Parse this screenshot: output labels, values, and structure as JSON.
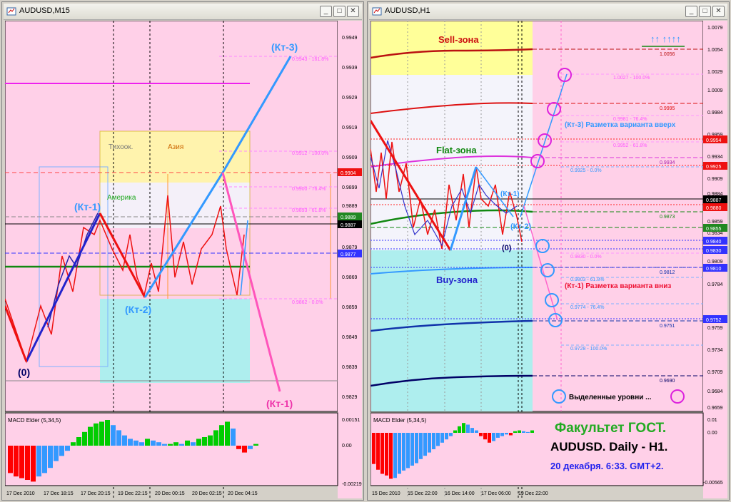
{
  "left_window": {
    "title": "AUDUSD,M15",
    "y_ticks": [
      "0.9949",
      "0.9939",
      "0.9929",
      "0.9919",
      "0.9909",
      "0.9899",
      "0.9889",
      "0.9879",
      "0.9869",
      "0.9859",
      "0.9849",
      "0.9839",
      "0.9829"
    ],
    "price_tags": [
      "0.9904",
      "0.9889",
      "0.9887",
      "0.9877"
    ],
    "fib_labels": [
      "0.9943 - 161.8%",
      "0.9912 - 100.0%",
      "0.9900 - 76.4%",
      "0.9893 - 61.8%",
      "0.9862 - 0.0%"
    ],
    "session_labels": [
      "Тихоок.",
      "Азия",
      "Америка"
    ],
    "wave_labels": [
      "(Кт-3)",
      "(Кт-1)",
      "(Кт-2)",
      "(0)",
      "(Кт-1)"
    ],
    "macd_title": "MACD Elder (5,34,5)",
    "macd_ticks": [
      "0.00151",
      "0.00",
      "-0.00219"
    ],
    "x_ticks": [
      "17 Dec 2010",
      "17 Dec 18:15",
      "17 Dec 20:15",
      "19 Dec 22:15",
      "20 Dec 00:15",
      "20 Dec 02:15",
      "20 Dec 04:15"
    ]
  },
  "right_window": {
    "title": "AUDUSD,H1",
    "y_ticks": [
      "1.0079",
      "1.0054",
      "1.0029",
      "1.0009",
      "0.9984",
      "0.9959",
      "0.9934",
      "0.9909",
      "0.9884",
      "0.9859",
      "0.9834",
      "0.9809",
      "0.9784",
      "0.9759",
      "0.9734",
      "0.9709",
      "0.9684",
      "0.9659"
    ],
    "price_tags": [
      "0.9954",
      "0.9925",
      "0.9887",
      "0.9880",
      "0.9855",
      "0.9840",
      "0.9830",
      "0.9810",
      "0.9752"
    ],
    "level_labels": [
      "1.0056",
      "0.9995",
      "0.9934",
      "0.9873",
      "0.9812",
      "0.9751",
      "0.9690"
    ],
    "fib_labels": [
      "1.0027 - 100.0%",
      "0.9981 - 76.4%",
      "0.9952 - 61.8%",
      "0.9925 - 0.0%",
      "0.9830 - 0.0%",
      "0.9803 - 61.8%",
      "0.9774 - 76.4%",
      "0.9728 - 100.0%"
    ],
    "zone_labels": [
      "Sell-зона",
      "Flat-зона",
      "Buy-зона"
    ],
    "wave_labels": [
      "(Кт-1)",
      "(Кт-2)",
      "(0)"
    ],
    "annotation_up": "(Кт-3) Разметка варианта вверх",
    "annotation_down": "(Кт-1) Разметка варианта вниз",
    "legend_text": "Выделенные уровни ...",
    "arrows_text": "↑↑ ↑↑↑↑",
    "macd_title": "MACD Elder (5,34,5)",
    "macd_ticks": [
      "0.01",
      "0.00",
      "-0.00565"
    ],
    "x_ticks": [
      "15 Dec 2010",
      "15 Dec 22:00",
      "16 Dec 14:00",
      "17 Dec 06:00",
      "19 Dec 22:00"
    ],
    "brand": "Факультет ГОСТ.",
    "headline": "AUDUSD. Daily - H1.",
    "date_line": "20 декабря. 6:33. GMT+2."
  },
  "colors": {
    "chart_bg": "#ffd0e8",
    "macd_green": "#00cc00",
    "macd_red": "#ff0000",
    "macd_blue": "#3399ff",
    "wave_blue": "#3399ff",
    "wave_red": "#ff0000",
    "wave_pink": "#ff66cc"
  },
  "chart_data": [
    {
      "type": "line",
      "name": "AUDUSD,M15",
      "ylim": [
        0.9823,
        0.9957
      ],
      "wave_points": [
        [
          0,
          0.9842
        ],
        [
          1,
          0.9889
        ],
        [
          2,
          0.9862
        ],
        [
          3,
          0.9904
        ],
        [
          4,
          0.9943
        ],
        [
          5,
          0.9829
        ]
      ],
      "horizontal_levels": [
        0.9904,
        0.9889,
        0.9887,
        0.9877,
        0.9872,
        0.9932
      ],
      "macd": [
        -0.0016,
        -0.0018,
        -0.0019,
        -0.002,
        -0.0021,
        -0.0018,
        -0.0016,
        -0.0013,
        -0.0009,
        -0.0006,
        -0.0003,
        0.0002,
        0.0005,
        0.0008,
        0.0011,
        0.0013,
        0.0014,
        0.0015,
        0.0012,
        0.0009,
        0.0006,
        0.0004,
        0.0003,
        0.0002,
        0.0004,
        0.0003,
        0.0002,
        0.0001,
        0.0001,
        0.0002,
        0.0001,
        0.0003,
        0.0002,
        0.0004,
        0.0005,
        0.0006,
        0.0009,
        0.0012,
        0.0014,
        0.001,
        -0.0002,
        -0.0004,
        -0.0002,
        0.0001
      ]
    },
    {
      "type": "line",
      "name": "AUDUSD,H1",
      "ylim": [
        0.9649,
        1.0089
      ],
      "wave_points": [
        [
          0,
          0.9944
        ],
        [
          1,
          0.9835
        ],
        [
          2,
          0.9912
        ],
        [
          3,
          0.9873
        ],
        [
          4,
          0.986
        ]
      ],
      "horizontal_levels": [
        1.0056,
        0.9995,
        0.9934,
        0.9873,
        0.9812,
        0.9751,
        0.969
      ],
      "circles_up": [
        1.0027,
        0.9981,
        0.9952,
        0.9925
      ],
      "circles_down": [
        0.983,
        0.9803,
        0.9774,
        0.9752
      ],
      "macd": [
        -0.0038,
        -0.0045,
        -0.005,
        -0.0052,
        -0.0056,
        -0.0055,
        -0.005,
        -0.0046,
        -0.0043,
        -0.004,
        -0.0037,
        -0.0032,
        -0.0028,
        -0.0024,
        -0.002,
        -0.0016,
        -0.0012,
        -0.0008,
        -0.0004,
        0.0003,
        0.0008,
        0.0012,
        0.001,
        0.0006,
        0.0003,
        -0.0004,
        -0.0008,
        -0.0012,
        -0.001,
        -0.0006,
        -0.0004,
        -0.0002,
        -0.0003,
        0.0002,
        0.0003,
        0.0002,
        0.0001,
        0.0003
      ]
    }
  ]
}
